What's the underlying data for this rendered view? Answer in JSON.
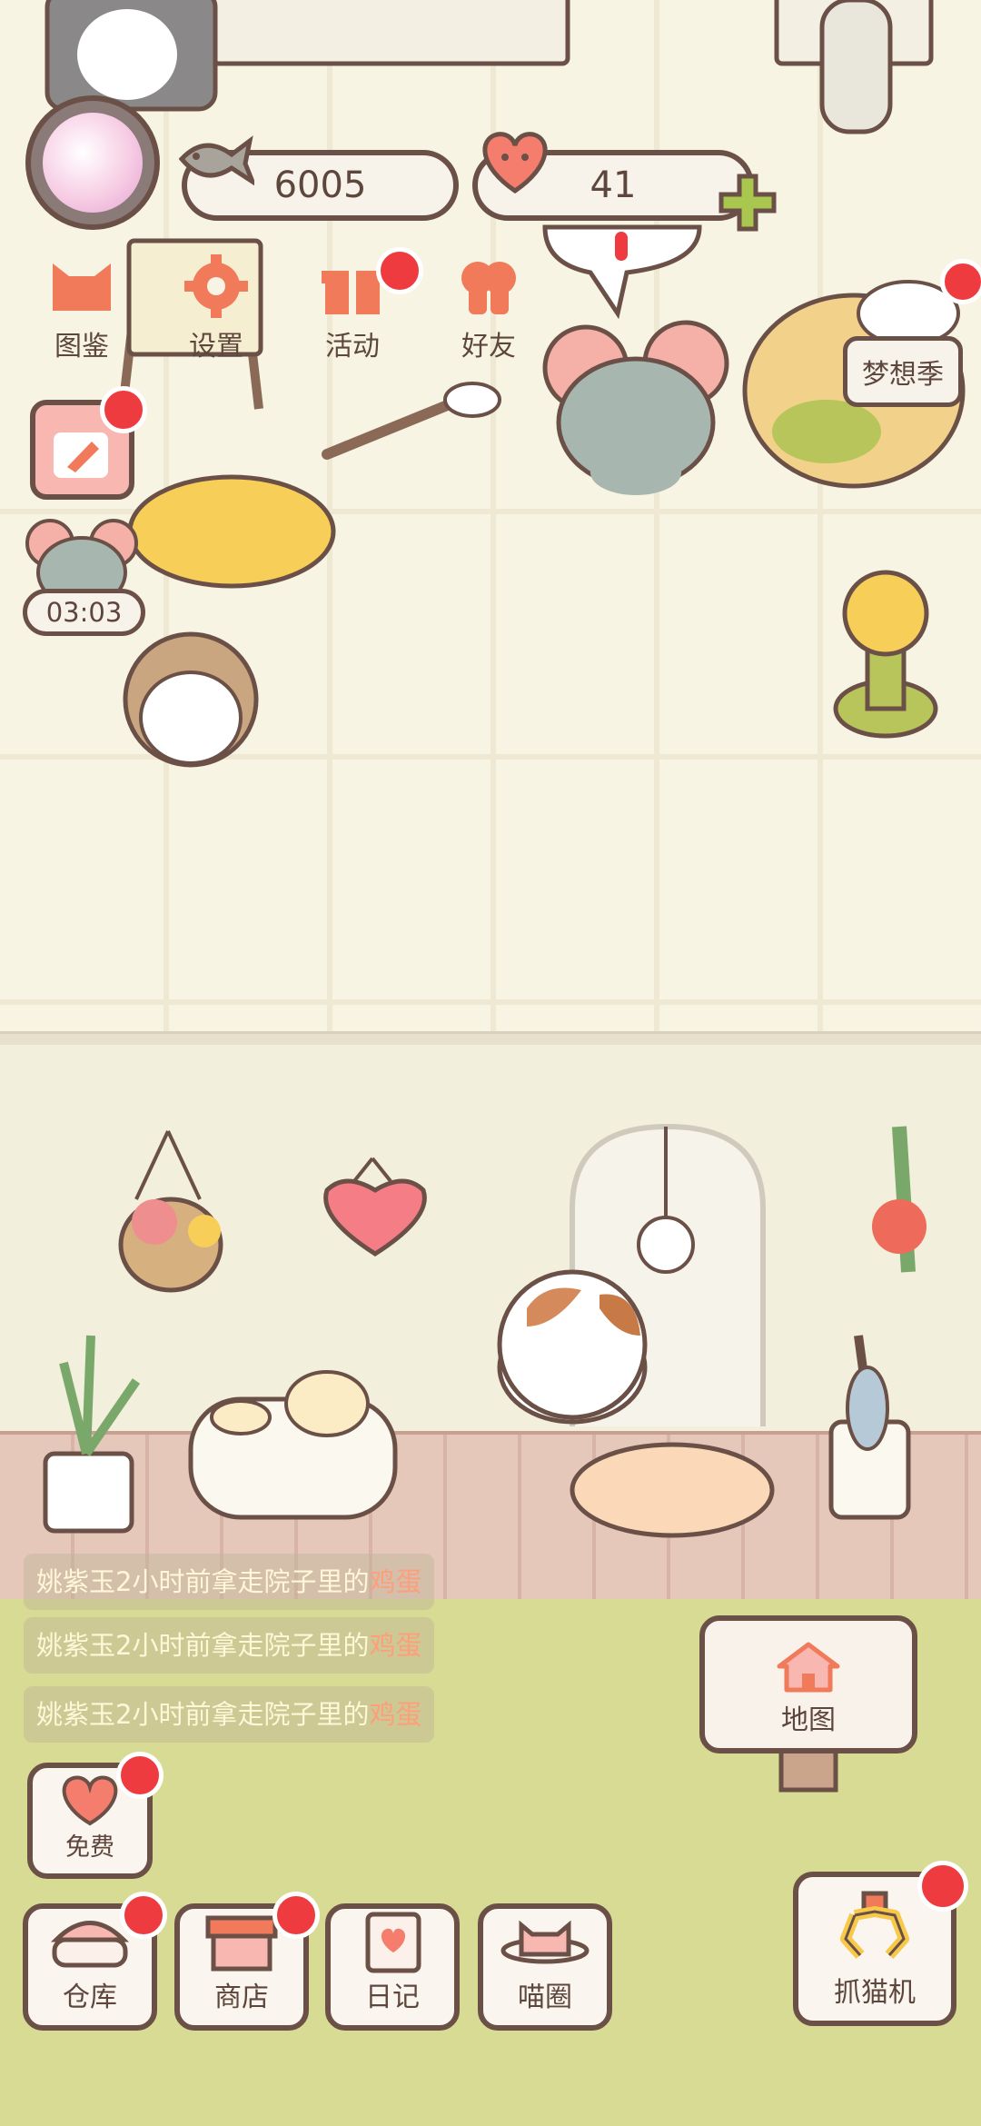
{
  "hud": {
    "fish_count": "6005",
    "heart_count": "41"
  },
  "menu": [
    {
      "label": "图鉴",
      "icon": "cat-head-icon"
    },
    {
      "label": "设置",
      "icon": "gear-icon"
    },
    {
      "label": "活动",
      "icon": "gift-icon"
    },
    {
      "label": "好友",
      "icon": "friends-icon"
    }
  ],
  "timer": "03:03",
  "season_label": "梦想季",
  "feed": [
    {
      "name": "姚紫玉",
      "text": "2小时前拿走院子里的",
      "item": "鸡蛋"
    },
    {
      "name": "姚紫玉",
      "text": "2小时前拿走院子里的",
      "item": "鸡蛋"
    },
    {
      "name": "姚紫玉",
      "text": "2小时前拿走院子里的",
      "item": "鸡蛋"
    }
  ],
  "map_label": "地图",
  "bottom": {
    "free": "免费",
    "warehouse": "仓库",
    "shop": "商店",
    "diary": "日记",
    "circle": "喵圈",
    "claw": "抓猫机"
  },
  "colors": {
    "badge_red": "#ee3b3f",
    "outline_brown": "#6a5046",
    "accent_orange": "#f07a5a",
    "grass": "#d7db93",
    "highlight_item": "#ff9e7a"
  }
}
